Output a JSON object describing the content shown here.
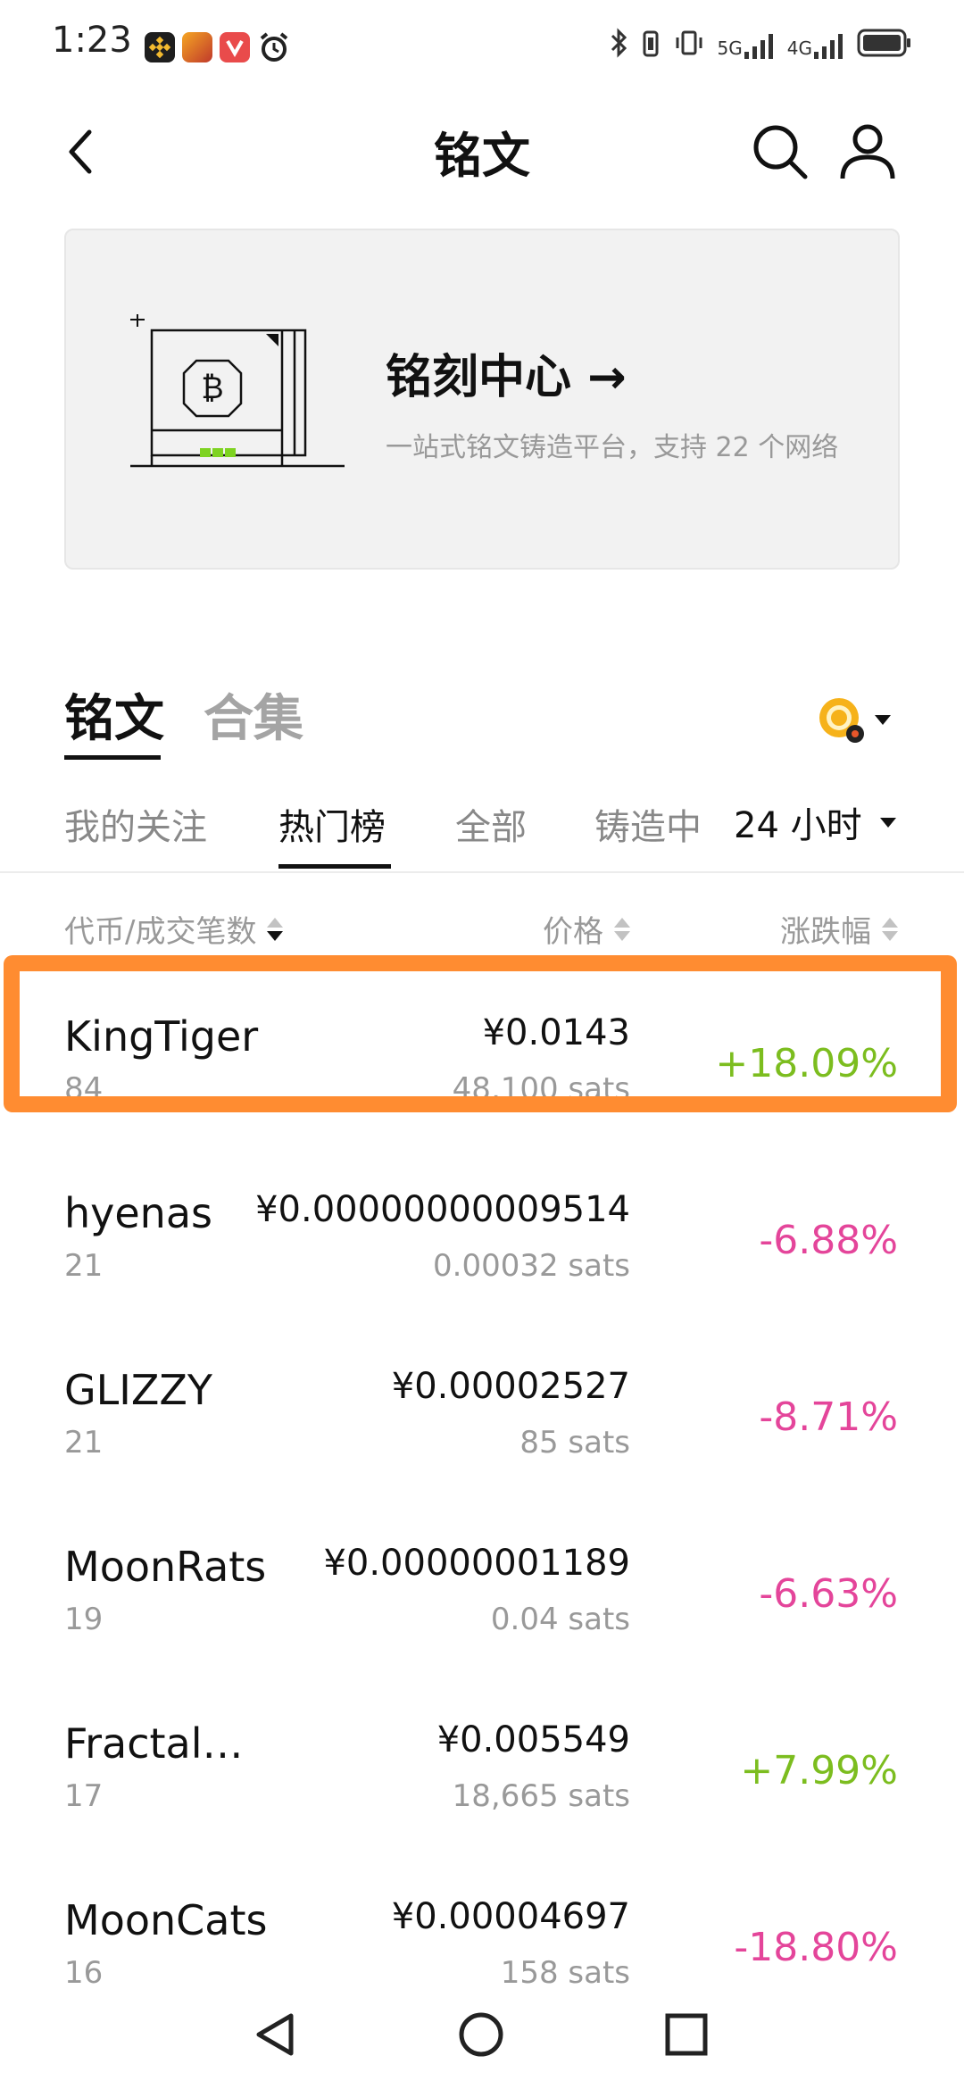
{
  "status": {
    "time": "1:23",
    "signal_labels": [
      "5G",
      "4G"
    ],
    "app_icons": [
      "binance-icon",
      "game-icon",
      "video-app-icon",
      "alarm-icon"
    ]
  },
  "header": {
    "title": "铭文",
    "back_icon": "chevron-left-icon",
    "search_icon": "search-icon",
    "profile_icon": "person-icon"
  },
  "banner": {
    "title": "铭刻中心 →",
    "subtitle": "一站式铭文铸造平台，支持 22 个网络"
  },
  "main_tabs": [
    {
      "label": "铭文",
      "active": true
    },
    {
      "label": "合集",
      "active": false
    }
  ],
  "sub_tabs": [
    {
      "label": "我的关注",
      "active": false
    },
    {
      "label": "热门榜",
      "active": true
    },
    {
      "label": "全部",
      "active": false
    },
    {
      "label": "铸造中",
      "active": false
    }
  ],
  "time_filter": "24 小时",
  "columns": {
    "token": "代币/成交笔数",
    "price": "价格",
    "change": "涨跌幅"
  },
  "rows": [
    {
      "name": "KingTiger",
      "count": "84",
      "price": "¥0.0143",
      "sats": "48,100 sats",
      "change": "+18.09%",
      "direction": "up"
    },
    {
      "name": "hyenas",
      "count": "21",
      "price": "¥0.00000000009514",
      "sats": "0.00032 sats",
      "change": "-6.88%",
      "direction": "down"
    },
    {
      "name": "GLIZZY",
      "count": "21",
      "price": "¥0.00002527",
      "sats": "85 sats",
      "change": "-8.71%",
      "direction": "down"
    },
    {
      "name": "MoonRats",
      "count": "19",
      "price": "¥0.00000001189",
      "sats": "0.04 sats",
      "change": "-6.63%",
      "direction": "down"
    },
    {
      "name": "Fractal…",
      "count": "17",
      "price": "¥0.005549",
      "sats": "18,665 sats",
      "change": "+7.99%",
      "direction": "up"
    },
    {
      "name": "MoonCats",
      "count": "16",
      "price": "¥0.00004697",
      "sats": "158 sats",
      "change": "-18.80%",
      "direction": "down"
    }
  ],
  "colors": {
    "up": "#7cbd1f",
    "down": "#e4459a",
    "highlight": "#ff8c31",
    "chip_green": "#7ed321"
  },
  "nav": [
    "back-nav-icon",
    "home-nav-icon",
    "recents-nav-icon"
  ]
}
